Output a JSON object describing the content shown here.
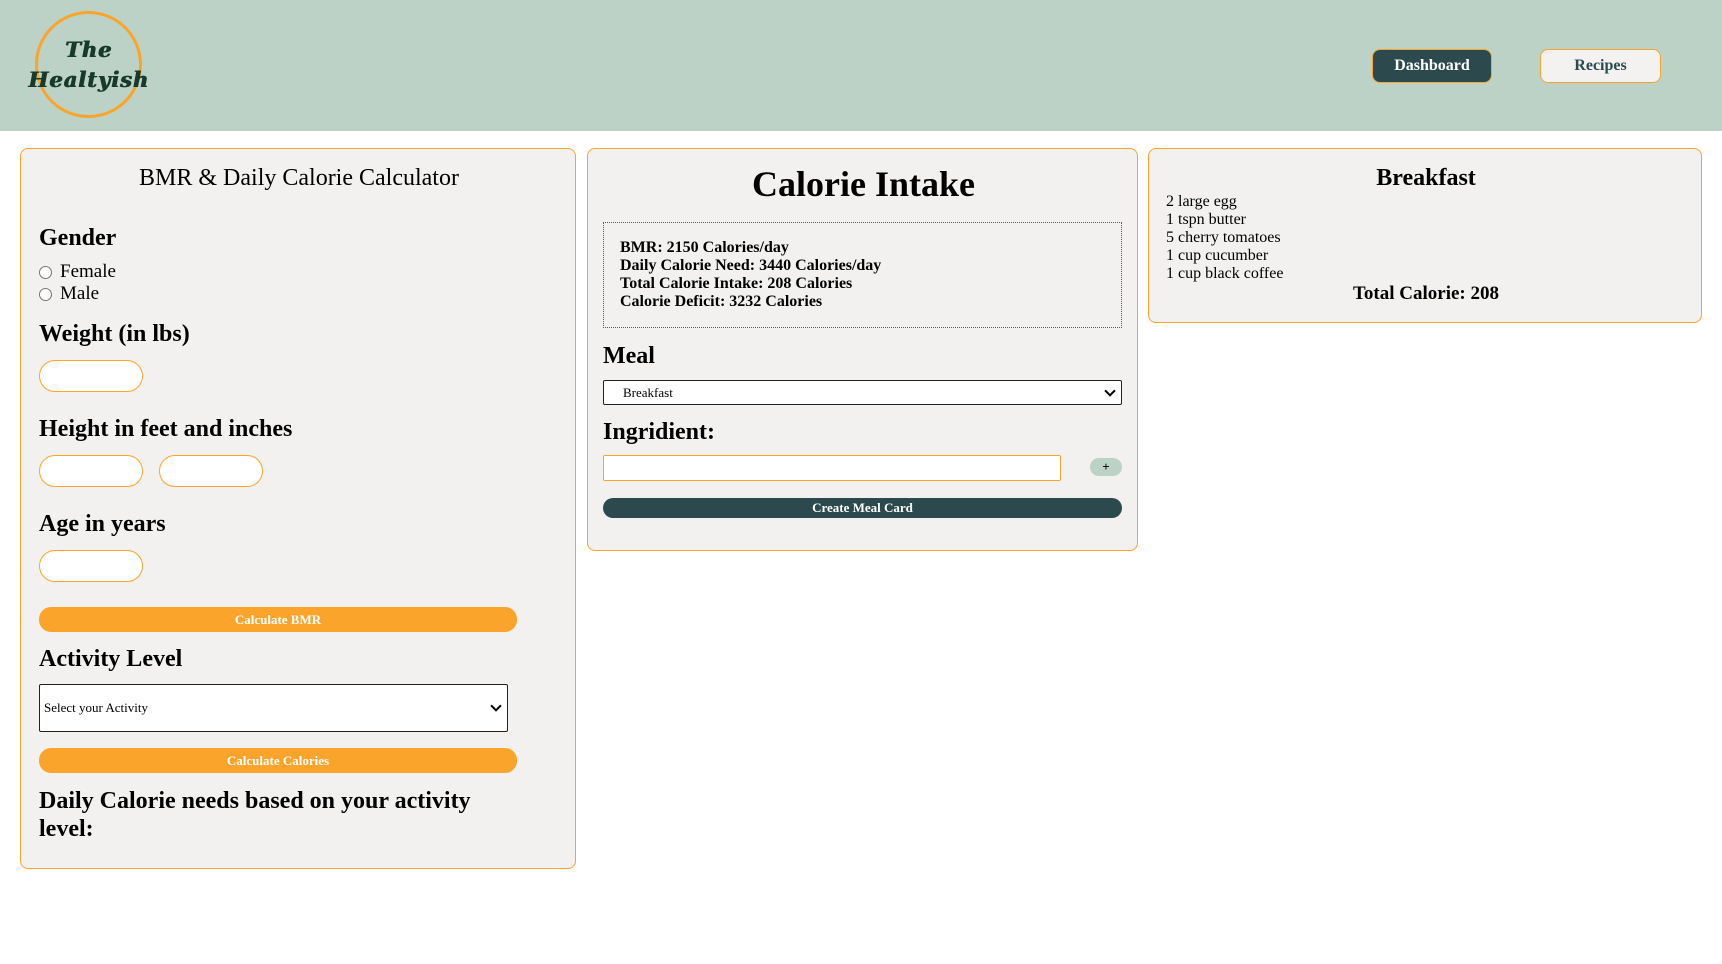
{
  "header": {
    "logo_line1": "The",
    "logo_line2": "Healtyish",
    "nav": {
      "dashboard": "Dashboard",
      "recipes": "Recipes"
    }
  },
  "bmr_calculator": {
    "title": "BMR & Daily Calorie Calculator",
    "gender_label": "Gender",
    "gender_options": [
      "Female",
      "Male"
    ],
    "weight_label": "Weight (in lbs)",
    "height_label": "Height in feet and inches",
    "age_label": "Age in years",
    "calculate_bmr_button": "Calculate BMR",
    "activity_label": "Activity Level",
    "activity_select_value": "Select your Activity",
    "calculate_calories_button": "Calculate Calories",
    "daily_calorie_label": "Daily Calorie needs based on your activity level:"
  },
  "calorie_intake": {
    "title": "Calorie Intake",
    "summary": {
      "bmr": "BMR: 2150 Calories/day",
      "daily_need": "Daily Calorie Need: 3440 Calories/day",
      "total_intake": "Total Calorie Intake: 208 Calories",
      "deficit": "Calorie Deficit: 3232 Calories"
    },
    "meal_label": "Meal",
    "meal_select_value": "Breakfast",
    "ingredient_label": "Ingridient:",
    "ingredient_value": "",
    "add_button": "+",
    "create_button": "Create Meal Card"
  },
  "meal_card": {
    "title": "Breakfast",
    "ingredients": [
      "2 large egg",
      "1 tspn butter",
      "5 cherry tomatoes",
      "1 cup cucumber",
      "1 cup black coffee"
    ],
    "total": "Total Calorie: 208"
  },
  "colors": {
    "header_bg": "#bcd2c6",
    "accent_orange": "#fba42c",
    "dark_teal": "#2c4a4e",
    "card_bg": "#f2f1f0",
    "summary_border": "#d62046"
  }
}
